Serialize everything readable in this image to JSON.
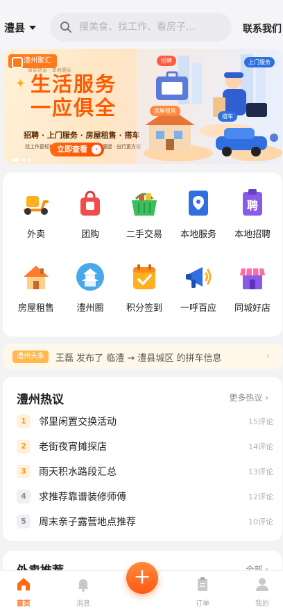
{
  "header": {
    "location": "澧县",
    "search_placeholder": "搜美食、找工作、看房子...",
    "contact_label": "联系我们"
  },
  "banner": {
    "brand": "澧州聚汇",
    "brand_sub": "真实信息 · 本地便民",
    "headline_1": "生活服务",
    "headline_2": "一应俱全",
    "services_line": "招聘 · 上门服务 · 房屋租售 · 搭车",
    "slogan_line": "找工作更轻松 · 找房更省心 · 上门更便捷 · 出行更方便",
    "cta_label": "立即查看",
    "bubble_recruit": "招聘",
    "bubble_home_service": "上门服务",
    "bubble_housing": "房屋租售",
    "bubble_ride": "搭车"
  },
  "services": [
    {
      "label": "外卖",
      "icon": "scooter-icon"
    },
    {
      "label": "团购",
      "icon": "shopping-bag-icon"
    },
    {
      "label": "二手交易",
      "icon": "basket-icon"
    },
    {
      "label": "本地服务",
      "icon": "map-pin-icon"
    },
    {
      "label": "本地招聘",
      "icon": "recruit-icon"
    },
    {
      "label": "房屋租售",
      "icon": "house-icon"
    },
    {
      "label": "澧州圈",
      "icon": "pagoda-icon"
    },
    {
      "label": "积分签到",
      "icon": "calendar-check-icon"
    },
    {
      "label": "一呼百应",
      "icon": "megaphone-icon"
    },
    {
      "label": "同城好店",
      "icon": "storefront-icon"
    }
  ],
  "ticker": {
    "tag": "澧州头条",
    "message": "王磊 发布了 临澧 → 澧县城区 的拼车信息"
  },
  "hot": {
    "title": "澧州热议",
    "more_label": "更多热议",
    "items": [
      {
        "rank": "1",
        "text": "邻里闲置交换活动",
        "count": "15评论"
      },
      {
        "rank": "2",
        "text": "老街夜宵摊探店",
        "count": "14评论"
      },
      {
        "rank": "3",
        "text": "雨天积水路段汇总",
        "count": "13评论"
      },
      {
        "rank": "4",
        "text": "求推荐靠谱装修师傅",
        "count": "12评论"
      },
      {
        "rank": "5",
        "text": "周末亲子露营地点推荐",
        "count": "10评论"
      }
    ]
  },
  "takeout": {
    "title": "外卖推荐",
    "more_label": "全部"
  },
  "nav": {
    "home": "首页",
    "messages": "消息",
    "orders": "订单",
    "mine": "我的",
    "fab": "+"
  },
  "colors": {
    "accent": "#ff6a13",
    "rank_hot_bg": "#fff1dc",
    "rank_hot_fg": "#ff9a1a",
    "rank_cold_bg": "#f0f0f3",
    "rank_cold_fg": "#8a8a93"
  }
}
